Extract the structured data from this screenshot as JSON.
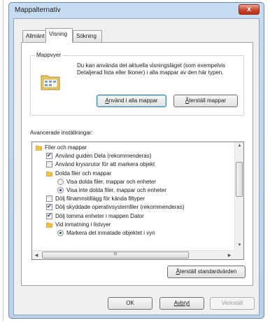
{
  "dialog": {
    "title": "Mappalternativ",
    "close_label": "x"
  },
  "tabs": [
    {
      "label": "Allmänt"
    },
    {
      "label": "Visning"
    },
    {
      "label": "Sökning"
    }
  ],
  "folder_views": {
    "legend": "Mappvyer",
    "description": "Du kan använda det aktuella visningsläget (som exempelvis Detaljerad lista eller Ikoner) i alla mappar av den här typen.",
    "apply_button": {
      "prefix": "",
      "accel": "A",
      "rest": "nvänd i alla mappar"
    },
    "reset_button": {
      "prefix": "",
      "accel": "Å",
      "rest": "terställ mappar"
    }
  },
  "advanced": {
    "label": "Avancerade inställningar:",
    "items": [
      {
        "type": "folder",
        "level": 0,
        "label": "Filer och mappar"
      },
      {
        "type": "checkbox",
        "level": 1,
        "checked": true,
        "label": "Använd guiden Dela (rekommenderas)"
      },
      {
        "type": "checkbox",
        "level": 1,
        "checked": false,
        "label": "Använd kryssrutor för att markera objekt"
      },
      {
        "type": "folder",
        "level": 1,
        "label": "Dolda filer och mappar"
      },
      {
        "type": "radio",
        "level": 2,
        "checked": false,
        "label": "Visa dolda filer, mappar och enheter"
      },
      {
        "type": "radio",
        "level": 2,
        "checked": true,
        "label": "Visa inte dolda filer, mappar och enheter"
      },
      {
        "type": "checkbox",
        "level": 1,
        "checked": false,
        "label": "Dölj filnamnstillägg för kända filtyper"
      },
      {
        "type": "checkbox",
        "level": 1,
        "checked": true,
        "label": "Dölj skyddade operativsystemfiler (rekommenderas)"
      },
      {
        "type": "checkbox",
        "level": 1,
        "checked": true,
        "label": "Dölj tomma enheter i mappen Dator"
      },
      {
        "type": "folder",
        "level": 1,
        "label": "Vid inmatning i listvyer"
      },
      {
        "type": "radio",
        "level": 2,
        "checked": true,
        "label": "Markera det inmatade objektet i vyn"
      }
    ],
    "hscroll_grip": "III"
  },
  "restore_defaults_button": {
    "prefix": "",
    "accel": "Å",
    "rest": "terställ standardvärden"
  },
  "footer": {
    "ok_label": "OK",
    "cancel_label": "Avbryt",
    "apply_label": "Verkställ"
  }
}
